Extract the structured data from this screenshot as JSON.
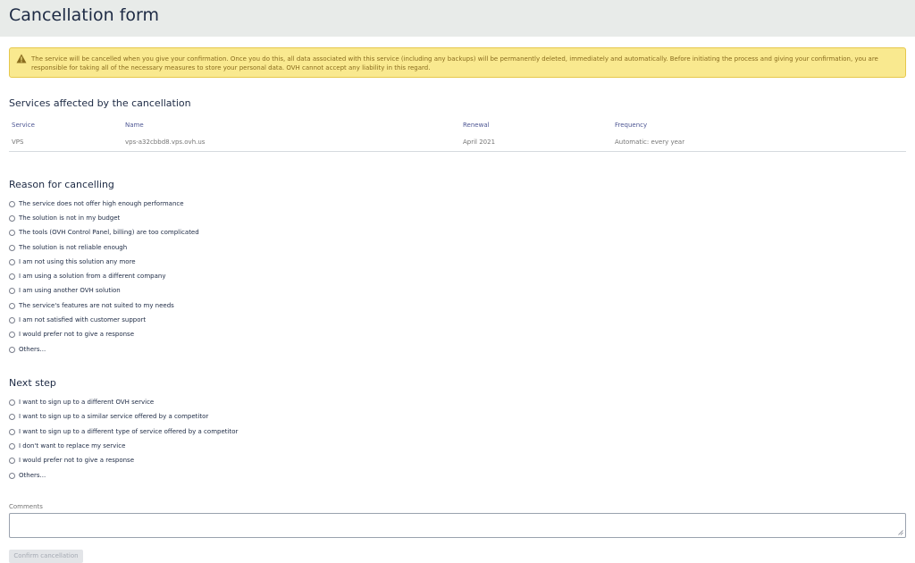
{
  "page": {
    "title": "Cancellation form"
  },
  "warning": {
    "icon": "warning-triangle-icon",
    "text": "The service will be cancelled when you give your confirmation. Once you do this, all data associated with this service (including any backups) will be permanently deleted, immediately and automatically. Before initiating the process and giving your confirmation, you are responsible for taking all of the necessary measures to store your personal data. OVH cannot accept any liability in this regard."
  },
  "services": {
    "title": "Services affected by the cancellation",
    "headers": {
      "service": "Service",
      "name": "Name",
      "renewal": "Renewal",
      "frequency": "Frequency"
    },
    "row": {
      "service": "VPS",
      "name": "vps-a32cbbd8.vps.ovh.us",
      "renewal": "April 2021",
      "frequency": "Automatic: every year"
    }
  },
  "reason": {
    "title": "Reason for cancelling",
    "options": [
      "The service does not offer high enough performance",
      "The solution is not in my budget",
      "The tools (OVH Control Panel, billing) are too complicated",
      "The solution is not reliable enough",
      "I am not using this solution any more",
      "I am using a solution from a different company",
      "I am using another OVH solution",
      "The service's features are not suited to my needs",
      "I am not satisfied with customer support",
      "I would prefer not to give a response",
      "Others..."
    ]
  },
  "next_step": {
    "title": "Next step",
    "options": [
      "I want to sign up to a different OVH service",
      "I want to sign up to a similar service offered by a competitor",
      "I want to sign up to a different type of service offered by a competitor",
      "I don't want to replace my service",
      "I would prefer not to give a response",
      "Others..."
    ]
  },
  "comments": {
    "label": "Comments",
    "value": ""
  },
  "actions": {
    "confirm_label": "Confirm cancellation"
  },
  "colors": {
    "header_bg": "#e8ebe9",
    "warning_bg": "#f9e98f",
    "warning_text": "#8a6d1e",
    "title": "#1d2a44",
    "accent": "#4d5693"
  }
}
